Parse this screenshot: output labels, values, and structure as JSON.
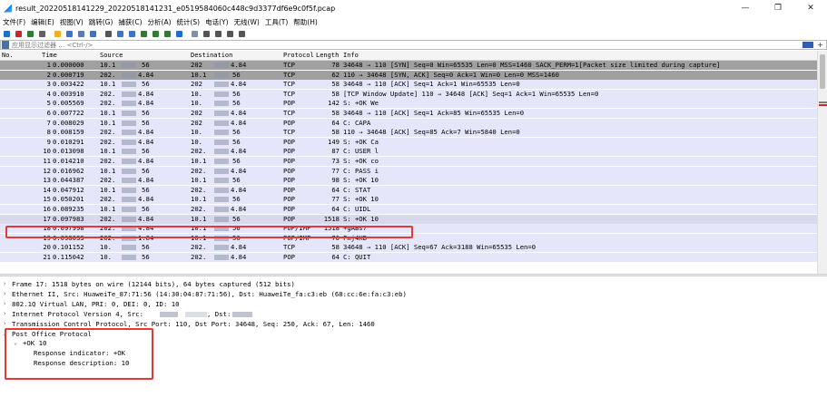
{
  "window": {
    "title": "result_20220518141229_20220518141231_e0519584060c448c9d3377df6e9c0f5f.pcap",
    "controls": {
      "minimize": "—",
      "maximize": "❐",
      "close": "✕"
    }
  },
  "menu": [
    "文件(F)",
    "编辑(E)",
    "视图(V)",
    "跳转(G)",
    "捕获(C)",
    "分析(A)",
    "统计(S)",
    "电话(Y)",
    "无线(W)",
    "工具(T)",
    "帮助(H)"
  ],
  "toolbar": {
    "icons": [
      {
        "name": "shark-fin-start-icon",
        "color": "#1e6fc9"
      },
      {
        "name": "stop-capture-icon",
        "color": "#c62828"
      },
      {
        "name": "restart-capture-icon",
        "color": "#2e7d32"
      },
      {
        "name": "capture-options-icon",
        "color": "#616161"
      },
      {
        "name": "open-file-icon",
        "color": "#f2b01e"
      },
      {
        "name": "save-file-icon",
        "color": "#3d74c4"
      },
      {
        "name": "close-file-icon",
        "color": "#5a7db5"
      },
      {
        "name": "reload-icon",
        "color": "#3d74c4"
      },
      {
        "name": "find-packet-icon",
        "color": "#555555"
      },
      {
        "name": "go-back-icon",
        "color": "#3d74c4"
      },
      {
        "name": "go-forward-icon",
        "color": "#3d74c4"
      },
      {
        "name": "go-to-packet-icon",
        "color": "#2e7d32"
      },
      {
        "name": "first-packet-icon",
        "color": "#2e7d32"
      },
      {
        "name": "last-packet-icon",
        "color": "#2e7d32"
      },
      {
        "name": "auto-scroll-icon",
        "color": "#1e6fc9"
      },
      {
        "name": "colorize-icon",
        "color": "#7b8fb0"
      },
      {
        "name": "zoom-in-icon",
        "color": "#555555"
      },
      {
        "name": "zoom-out-icon",
        "color": "#555555"
      },
      {
        "name": "normal-size-icon",
        "color": "#555555"
      },
      {
        "name": "resize-columns-icon",
        "color": "#555555"
      }
    ]
  },
  "filter": {
    "placeholder": "应用显示过滤器 … <Ctrl-/>"
  },
  "columns": {
    "no": "No.",
    "time": "Time",
    "source": "Source",
    "destination": "Destination",
    "protocol": "Protocol",
    "length": "Length",
    "info": "Info"
  },
  "colors": {
    "row_gray": "#a0a0a0",
    "row_blue": "#e6e6fa",
    "row_selected": "#d9d9ed",
    "highlight_red": "#e53935"
  },
  "packets": [
    {
      "no": "1",
      "time": "0.000000",
      "src": "10.1",
      "src2": "56",
      "dst": "202",
      "dst2": "4.84",
      "proto": "TCP",
      "len": "78",
      "info": "34648 → 110 [SYN] Seq=0 Win=65535 Len=0 MSS=1460 SACK_PERM=1[Packet size limited during capture]",
      "style": "gray"
    },
    {
      "no": "2",
      "time": "0.000719",
      "src": "202.",
      "src2": "4.84",
      "dst": "10.1",
      "dst2": "56",
      "proto": "TCP",
      "len": "62",
      "info": "110 → 34648 [SYN, ACK] Seq=0 Ack=1 Win=0 Len=0 MSS=1460",
      "style": "gray"
    },
    {
      "no": "3",
      "time": "0.003422",
      "src": "10.1",
      "src2": "56",
      "dst": "202",
      "dst2": "4.84",
      "proto": "TCP",
      "len": "58",
      "info": "34648 → 110 [ACK] Seq=1 Ack=1 Win=65535 Len=0",
      "style": "blue"
    },
    {
      "no": "4",
      "time": "0.003910",
      "src": "202.",
      "src2": "4.84",
      "dst": "10.",
      "dst2": "56",
      "proto": "TCP",
      "len": "58",
      "info": "[TCP Window Update] 110 → 34648 [ACK] Seq=1 Ack=1 Win=65535 Len=0",
      "style": "blue"
    },
    {
      "no": "5",
      "time": "0.005569",
      "src": "202.",
      "src2": "4.84",
      "dst": "10.",
      "dst2": "56",
      "proto": "POP",
      "len": "142",
      "info": "S: +OK We",
      "style": "blue"
    },
    {
      "no": "6",
      "time": "0.007722",
      "src": "10.1",
      "src2": "56",
      "dst": "202",
      "dst2": "4.84",
      "proto": "TCP",
      "len": "58",
      "info": "34648 → 110 [ACK] Seq=1 Ack=85 Win=65535 Len=0",
      "style": "blue"
    },
    {
      "no": "7",
      "time": "0.008029",
      "src": "10.1",
      "src2": "56",
      "dst": "202",
      "dst2": "4.84",
      "proto": "POP",
      "len": "64",
      "info": "C: CAPA",
      "style": "blue"
    },
    {
      "no": "8",
      "time": "0.008159",
      "src": "202.",
      "src2": "4.84",
      "dst": "10.",
      "dst2": "56",
      "proto": "TCP",
      "len": "58",
      "info": "110 → 34648 [ACK] Seq=85 Ack=7 Win=5840 Len=0",
      "style": "blue"
    },
    {
      "no": "9",
      "time": "0.010291",
      "src": "202.",
      "src2": "4.84",
      "dst": "10.",
      "dst2": "56",
      "proto": "POP",
      "len": "149",
      "info": "S: +OK Ca",
      "style": "blue"
    },
    {
      "no": "10",
      "time": "0.013098",
      "src": "10.1",
      "src2": "56",
      "dst": "202.",
      "dst2": "4.84",
      "proto": "POP",
      "len": "87",
      "info": "C: USER l",
      "style": "blue"
    },
    {
      "no": "11",
      "time": "0.014210",
      "src": "202.",
      "src2": "4.84",
      "dst": "10.1",
      "dst2": "56",
      "proto": "POP",
      "len": "73",
      "info": "S: +OK co",
      "style": "blue"
    },
    {
      "no": "12",
      "time": "0.016962",
      "src": "10.1",
      "src2": "56",
      "dst": "202.",
      "dst2": "4.84",
      "proto": "POP",
      "len": "77",
      "info": "C: PASS i",
      "style": "blue"
    },
    {
      "no": "13",
      "time": "0.044387",
      "src": "202.",
      "src2": "4.84",
      "dst": "10.1",
      "dst2": "56",
      "proto": "POP",
      "len": "98",
      "info": "S: +OK 10",
      "style": "blue"
    },
    {
      "no": "14",
      "time": "0.047912",
      "src": "10.1",
      "src2": "56",
      "dst": "202.",
      "dst2": "4.84",
      "proto": "POP",
      "len": "64",
      "info": "C: STAT",
      "style": "blue"
    },
    {
      "no": "15",
      "time": "0.050201",
      "src": "202.",
      "src2": "4.84",
      "dst": "10.1",
      "dst2": "56",
      "proto": "POP",
      "len": "77",
      "info": "S: +OK 10",
      "style": "blue"
    },
    {
      "no": "16",
      "time": "0.089235",
      "src": "10.1",
      "src2": "56",
      "dst": "202.",
      "dst2": "4.84",
      "proto": "POP",
      "len": "64",
      "info": "C: UIDL",
      "style": "blue"
    },
    {
      "no": "17",
      "time": "0.097983",
      "src": "202.",
      "src2": "4.84",
      "dst": "10.1",
      "dst2": "56",
      "proto": "POP",
      "len": "1518",
      "info": "S: +OK 10",
      "style": "selected"
    },
    {
      "no": "18",
      "time": "0.097998",
      "src": "202.",
      "src2": "4.84",
      "dst": "10.1",
      "dst2": "56",
      "proto": "POP/IMF",
      "len": "1518",
      "info": "+gABs7",
      "style": "blue"
    },
    {
      "no": "19",
      "time": "0.098033",
      "src": "202.",
      "src2": "1.84",
      "dst": "10.1",
      "dst2": "56",
      "proto": "POP/IMF",
      "len": "76",
      "info": "Fmj4XB",
      "style": "blue"
    },
    {
      "no": "20",
      "time": "0.101152",
      "src": "10.",
      "src2": "56",
      "dst": "202.",
      "dst2": "4.84",
      "proto": "TCP",
      "len": "58",
      "info": "34648 → 110 [ACK] Seq=67 Ack=3188 Win=65535 Len=0",
      "style": "blue"
    },
    {
      "no": "21",
      "time": "0.115042",
      "src": "10.",
      "src2": "56",
      "dst": "202.",
      "dst2": "4.84",
      "proto": "POP",
      "len": "64",
      "info": "C: QUIT",
      "style": "blue"
    }
  ],
  "details": [
    {
      "arrow": "›",
      "indent": 0,
      "text": "Frame 17: 1518 bytes on wire (12144 bits), 64 bytes captured (512 bits)"
    },
    {
      "arrow": "›",
      "indent": 0,
      "text": "Ethernet II, Src: HuaweiTe_87:71:56 (14:30:04:87:71:56), Dst: HuaweiTe_fa:c3:eb (68:cc:6e:fa:c3:eb)"
    },
    {
      "arrow": "›",
      "indent": 0,
      "text": "802.1Q Virtual LAN, PRI: 0, DEI: 0, ID: 10"
    },
    {
      "arrow": "›",
      "indent": 0,
      "text": "Internet Protocol Version 4, Src:",
      "redact_after": true,
      "text2": ", Dst:"
    },
    {
      "arrow": "›",
      "indent": 0,
      "text": "Transmission Control Protocol, Src Port: 110, Dst Port: 34648, Seq: 250, Ack: 67, Len: 1460"
    },
    {
      "arrow": "⌄",
      "indent": 0,
      "text": "Post Office Protocol"
    },
    {
      "arrow": "⌄",
      "indent": 1,
      "text": "+OK 10"
    },
    {
      "arrow": "",
      "indent": 2,
      "text": "Response indicator: +OK"
    },
    {
      "arrow": "",
      "indent": 2,
      "text": "Response description: 10"
    }
  ]
}
